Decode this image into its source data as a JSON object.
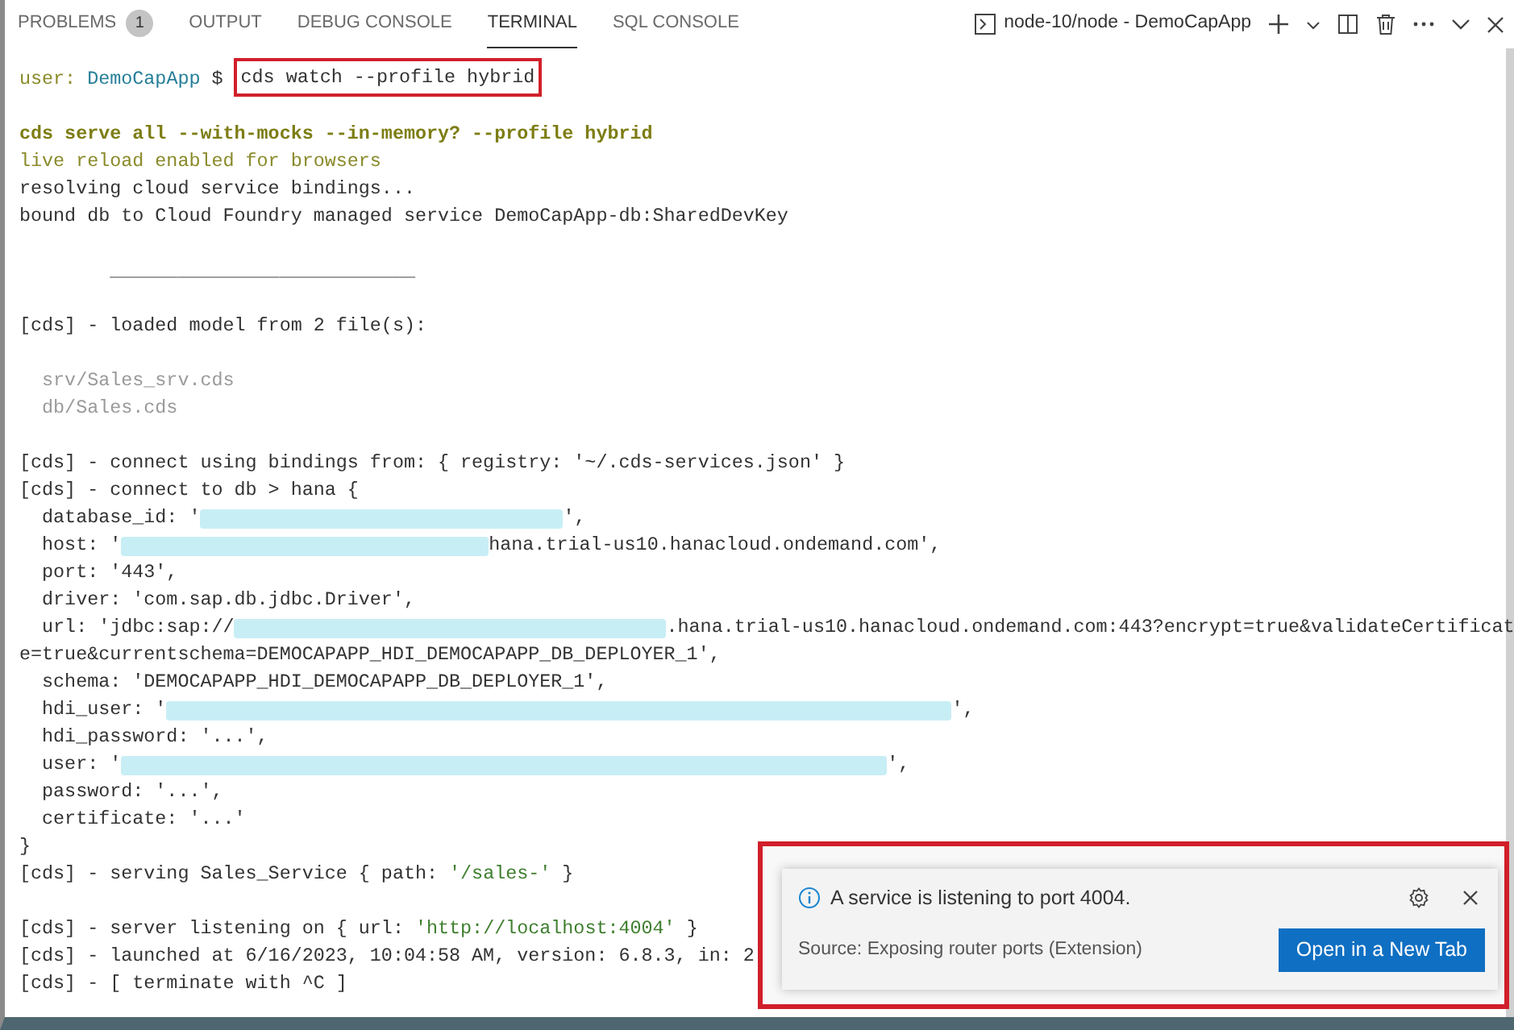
{
  "panel_tabs": [
    {
      "label": "PROBLEMS",
      "badge": "1",
      "selected": false
    },
    {
      "label": "OUTPUT",
      "selected": false
    },
    {
      "label": "DEBUG CONSOLE",
      "selected": false
    },
    {
      "label": "TERMINAL",
      "selected": true
    },
    {
      "label": "SQL CONSOLE",
      "selected": false
    }
  ],
  "terminal_selector": {
    "label": "node-10/node - DemoCapApp"
  },
  "terminal": {
    "blocks": [
      [
        {
          "kind": "prompt",
          "segments": [
            {
              "color": "#8a8a2a",
              "text": "user: "
            },
            {
              "color": "#267f99",
              "text": "DemoCapApp"
            },
            {
              "color": "#333333",
              "text": " $ "
            }
          ],
          "command": "cds watch --profile hybrid"
        }
      ],
      [
        {
          "segments": [
            {
              "color": "#7d7d14",
              "bold": true,
              "text": "cds serve all --with-mocks --in-memory? --profile hybrid"
            }
          ]
        },
        {
          "segments": [
            {
              "color": "#8a8a2a",
              "text": "live reload enabled for browsers"
            }
          ]
        },
        {
          "segments": [
            {
              "color": "#333333",
              "text": "resolving cloud service bindings..."
            }
          ]
        },
        {
          "segments": [
            {
              "color": "#333333",
              "text": "bound db to Cloud Foundry managed service DemoCapApp-db:SharedDevKey"
            }
          ]
        }
      ],
      [
        {
          "segments": [
            {
              "text": "        ___________________________"
            }
          ]
        }
      ],
      [
        {
          "segments": [
            {
              "color": "#333333",
              "text": "[cds] - loaded model from 2 file(s):"
            }
          ]
        }
      ],
      [
        {
          "segments": [
            {
              "color": "#9a9a9a",
              "text": "  srv/Sales_srv.cds"
            }
          ]
        },
        {
          "segments": [
            {
              "color": "#9a9a9a",
              "text": "  db/Sales.cds"
            }
          ]
        }
      ],
      [
        {
          "segments": [
            {
              "color": "#333333",
              "text": "[cds] - connect using bindings from: { registry: '~/.cds-services.json' }"
            }
          ]
        },
        {
          "segments": [
            {
              "color": "#333333",
              "text": "[cds] - connect to db > hana {"
            }
          ]
        },
        {
          "segments": [
            {
              "color": "#333333",
              "text": "  database_id: '"
            },
            {
              "kind": "redacted"
            },
            {
              "color": "#333333",
              "text": "',"
            }
          ]
        },
        {
          "segments": [
            {
              "color": "#333333",
              "text": "  host: '"
            },
            {
              "kind": "redacted"
            },
            {
              "color": "#333333",
              "text": "hana.trial-us10.hanacloud.ondemand.com',"
            }
          ]
        },
        {
          "segments": [
            {
              "color": "#333333",
              "text": "  port: '443',"
            }
          ]
        },
        {
          "segments": [
            {
              "color": "#333333",
              "text": "  driver: 'com.sap.db.jdbc.Driver',"
            }
          ]
        },
        {
          "segments": [
            {
              "color": "#333333",
              "text": "  url: 'jdbc:sap://"
            },
            {
              "kind": "redacted"
            },
            {
              "color": "#333333",
              "text": ".hana.trial-us10.hanacloud.ondemand.com:443?encrypt=true&validateCertificat"
            }
          ]
        },
        {
          "segments": [
            {
              "color": "#333333",
              "text": "e=true&currentschema=DEMOCAPAPP_HDI_DEMOCAPAPP_DB_DEPLOYER_1',"
            }
          ]
        },
        {
          "segments": [
            {
              "color": "#333333",
              "text": "  schema: 'DEMOCAPAPP_HDI_DEMOCAPAPP_DB_DEPLOYER_1',"
            }
          ]
        },
        {
          "segments": [
            {
              "color": "#333333",
              "text": "  hdi_user: '"
            },
            {
              "kind": "redacted"
            },
            {
              "color": "#333333",
              "text": "',"
            }
          ]
        },
        {
          "segments": [
            {
              "color": "#333333",
              "text": "  hdi_password: '...',"
            }
          ]
        },
        {
          "segments": [
            {
              "color": "#333333",
              "text": "  user: '"
            },
            {
              "kind": "redacted"
            },
            {
              "color": "#333333",
              "text": "',"
            }
          ]
        },
        {
          "segments": [
            {
              "color": "#333333",
              "text": "  password: '...',"
            }
          ]
        },
        {
          "segments": [
            {
              "color": "#333333",
              "text": "  certificate: '...'"
            }
          ]
        },
        {
          "segments": [
            {
              "color": "#333333",
              "text": "}"
            }
          ]
        },
        {
          "segments": [
            {
              "color": "#333333",
              "text": "[cds] - serving Sales_Service { path: "
            },
            {
              "color": "#3f7f2f",
              "text": "'/sales-'"
            },
            {
              "color": "#333333",
              "text": " }"
            }
          ]
        }
      ],
      [
        {
          "segments": [
            {
              "color": "#333333",
              "text": "[cds] - server listening on { url: "
            },
            {
              "color": "#3f7f2f",
              "text": "'http://localhost:4004'"
            },
            {
              "color": "#333333",
              "text": " }"
            }
          ]
        },
        {
          "segments": [
            {
              "color": "#333333",
              "text": "[cds] - launched at 6/16/2023, 10:04:58 AM, version: 6.8.3, in: 2"
            }
          ]
        },
        {
          "segments": [
            {
              "color": "#333333",
              "text": "[cds] - [ terminate with ^C ]"
            }
          ]
        }
      ]
    ]
  },
  "notification": {
    "message": "A service is listening to port 4004.",
    "source": "Source: Exposing router ports (Extension)",
    "action": "Open in a New Tab"
  }
}
